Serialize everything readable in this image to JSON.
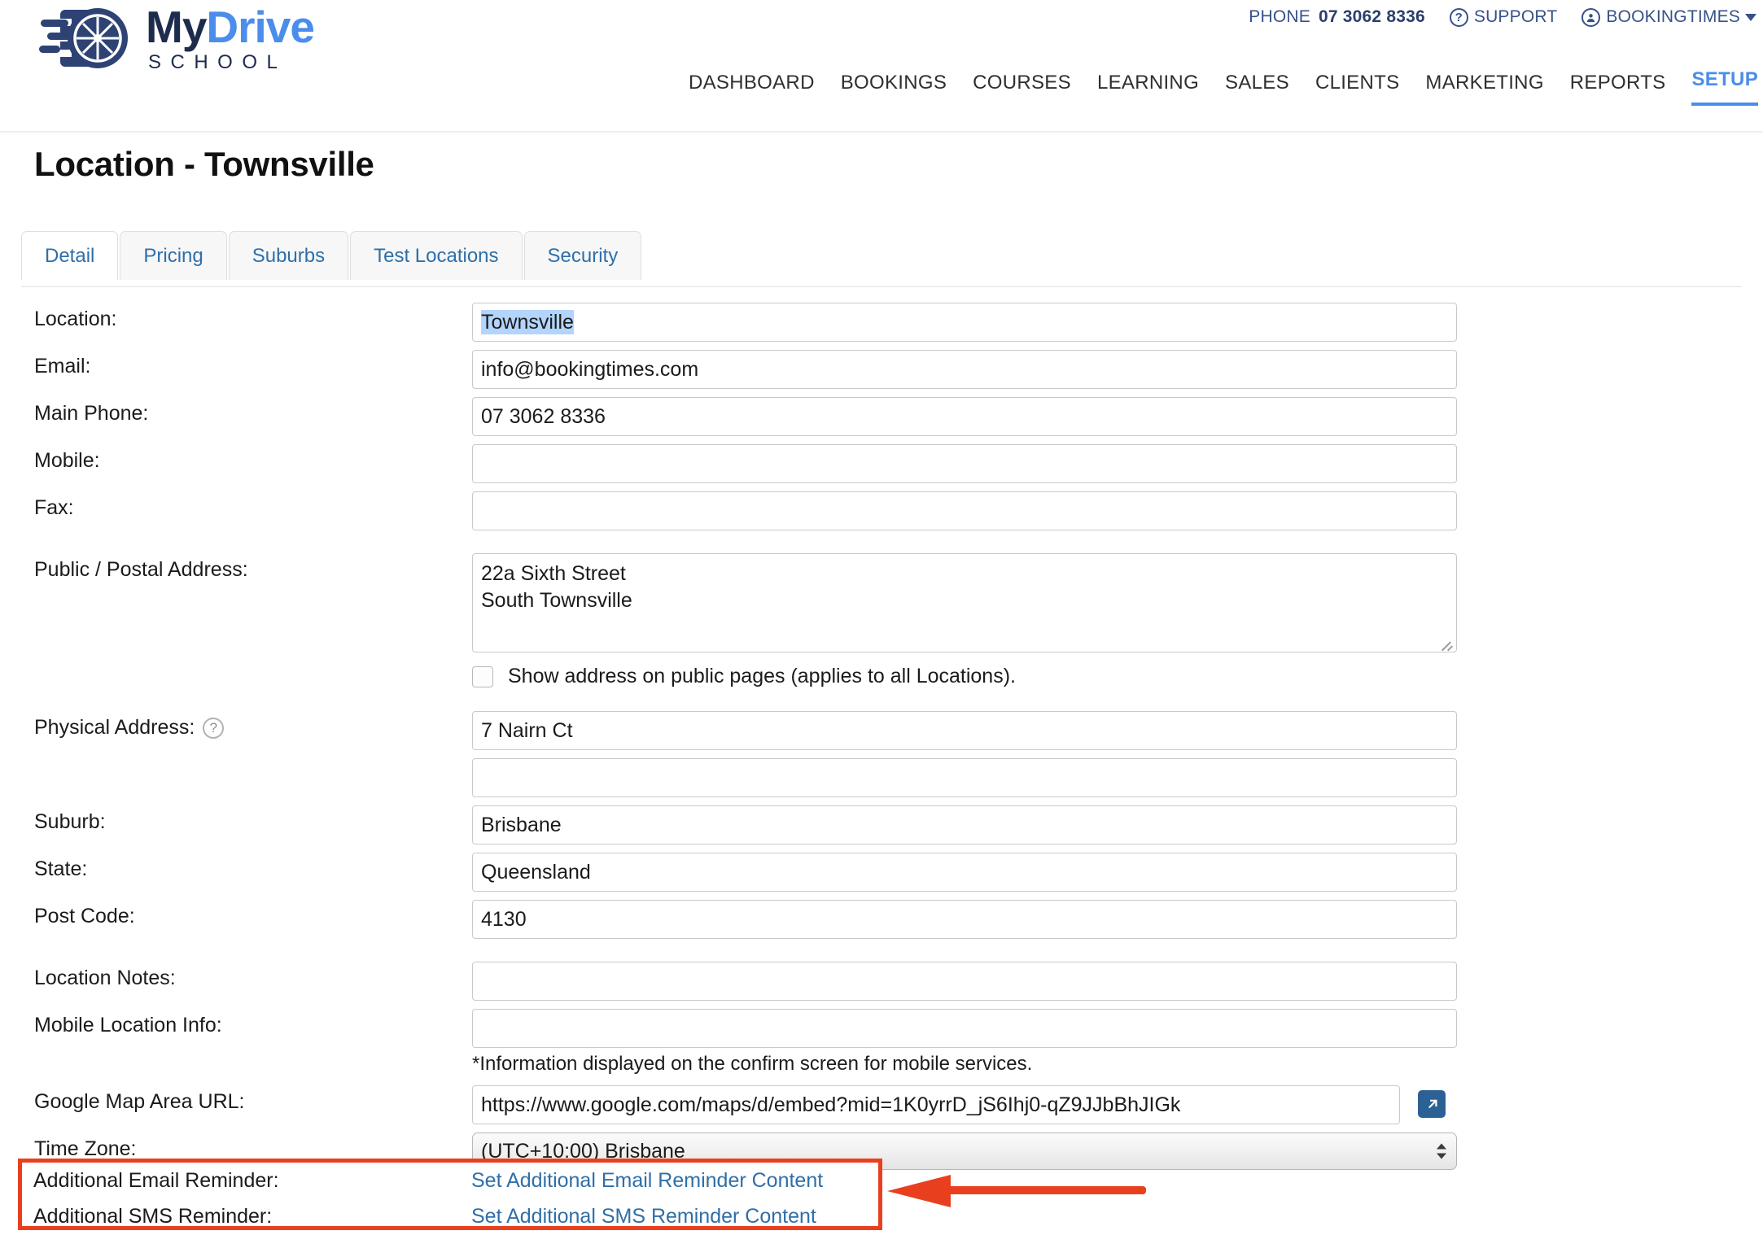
{
  "topbar": {
    "phone_label": "PHONE",
    "phone_number": "07 3062 8336",
    "support_label": "SUPPORT",
    "account_label": "BOOKINGTIMES",
    "support_icon": "question-circle-icon",
    "account_icon": "user-circle-icon",
    "color": "#36518a"
  },
  "logo": {
    "text_my": "My",
    "text_drive": "Drive",
    "text_school": "SCHOOL",
    "icon": "wheel-motion-icon",
    "navy": "#1d2b4d",
    "blue": "#4b8dea"
  },
  "nav": {
    "accent": "#4b8dea",
    "items": [
      {
        "label": "DASHBOARD",
        "active": false
      },
      {
        "label": "BOOKINGS",
        "active": false
      },
      {
        "label": "COURSES",
        "active": false
      },
      {
        "label": "LEARNING",
        "active": false
      },
      {
        "label": "SALES",
        "active": false
      },
      {
        "label": "CLIENTS",
        "active": false
      },
      {
        "label": "MARKETING",
        "active": false
      },
      {
        "label": "REPORTS",
        "active": false
      },
      {
        "label": "SETUP",
        "active": true
      }
    ]
  },
  "page": {
    "title": "Location - Townsville"
  },
  "tabs": [
    {
      "label": "Detail",
      "active": true
    },
    {
      "label": "Pricing",
      "active": false
    },
    {
      "label": "Suburbs",
      "active": false
    },
    {
      "label": "Test Locations",
      "active": false
    },
    {
      "label": "Security",
      "active": false
    }
  ],
  "form": {
    "location_label": "Location:",
    "location_value": "Townsville",
    "email_label": "Email:",
    "email_value": "info@bookingtimes.com",
    "main_phone_label": "Main Phone:",
    "main_phone_value": "07 3062 8336",
    "mobile_label": "Mobile:",
    "mobile_value": "",
    "fax_label": "Fax:",
    "fax_value": "",
    "postal_label": "Public / Postal Address:",
    "postal_value": "22a Sixth Street\nSouth Townsville",
    "show_address_label": "Show address on public pages (applies to all Locations).",
    "show_address_checked": false,
    "physical_label": "Physical Address:",
    "physical_help_icon": "help-circle-icon",
    "physical_value_1": "7 Nairn Ct",
    "physical_value_2": "",
    "suburb_label": "Suburb:",
    "suburb_value": "Brisbane",
    "state_label": "State:",
    "state_value": "Queensland",
    "postcode_label": "Post Code:",
    "postcode_value": "4130",
    "notes_label": "Location Notes:",
    "notes_value": "",
    "mobile_info_label": "Mobile Location Info:",
    "mobile_info_value": "",
    "mobile_info_hint": "*Information displayed on the confirm screen for mobile services.",
    "map_url_label": "Google Map Area URL:",
    "map_url_value": "https://www.google.com/maps/d/embed?mid=1K0yrrD_jS6Ihj0-qZ9JJbBhJIGk",
    "map_open_icon": "external-link-icon",
    "timezone_label": "Time Zone:",
    "timezone_value": "(UTC+10:00) Brisbane"
  },
  "reminders": {
    "email_label": "Additional Email Reminder:",
    "email_link": "Set Additional Email Reminder Content",
    "sms_label": "Additional SMS Reminder:",
    "sms_link": "Set Additional SMS Reminder Content",
    "highlight_color": "#e8401f",
    "link_color": "#2f6fa8"
  },
  "annotation": {
    "arrow_icon": "left-arrow-annotation",
    "color": "#e8401f"
  }
}
